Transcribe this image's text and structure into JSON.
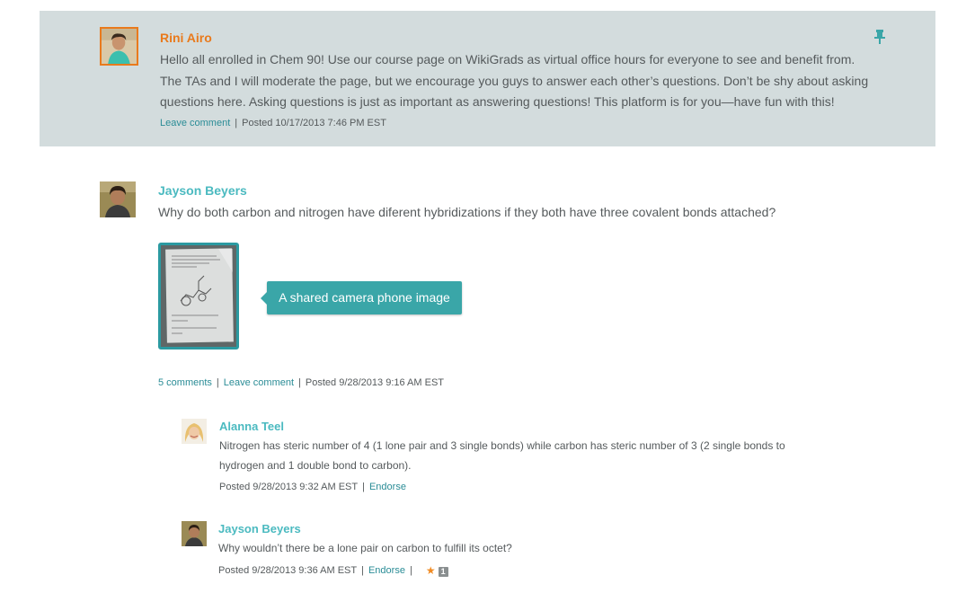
{
  "colors": {
    "pinned_bg": "#d3dcdd",
    "author_pinned": "#e97a1c",
    "author": "#4bbac0",
    "link": "#2a8c96",
    "callout_bg": "#3aa6a8",
    "star": "#f08b24"
  },
  "pinned_post": {
    "author": "Rini Airo",
    "body_lines": [
      "Hello all enrolled in Chem 90! Use our course page on WikiGrads as virtual office hours for everyone to see and benefit from.",
      "The TAs and I will moderate the page, but we encourage you guys to answer each other’s questions. Don’t be shy about asking",
      "questions here. Asking questions is just as important as answering questions! This platform is for you—have fun with this!"
    ],
    "leave_comment": "Leave comment",
    "posted": "Posted 10/17/2013 7:46 PM EST",
    "pin_icon": "pin-icon"
  },
  "question": {
    "author": "Jayson Beyers",
    "body": "Why do both carbon and nitrogen have diferent hybridizations if they both have three covalent bonds attached?",
    "image_caption": "A shared camera phone image",
    "comments_count": "5 comments",
    "leave_comment": "Leave comment",
    "posted": "Posted 9/28/2013 9:16 AM EST"
  },
  "replies": [
    {
      "author": "Alanna Teel",
      "body_lines": [
        "Nitrogen has steric number of 4 (1 lone pair and 3 single bonds) while carbon has steric number of 3 (2 single bonds to",
        "hydrogen and 1 double bond to carbon)."
      ],
      "posted": "Posted 9/28/2013 9:32 AM EST",
      "endorse": "Endorse"
    },
    {
      "author": "Jayson Beyers",
      "body_lines": [
        "Why wouldn’t there be a lone pair on carbon to fulfill its octet?"
      ],
      "posted": "Posted 9/28/2013 9:36 AM EST",
      "endorse": "Endorse",
      "star_icon": "star-icon",
      "endorse_count": "1"
    }
  ]
}
